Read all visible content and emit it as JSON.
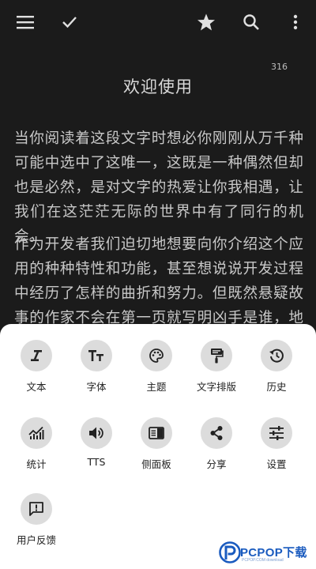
{
  "toolbar": {
    "icons": [
      "menu-icon",
      "check-icon",
      "star-icon",
      "search-icon",
      "more-vert-icon"
    ]
  },
  "reader": {
    "page_number": "316",
    "chapter_title": "欢迎使用",
    "paragraph_1": "当你阅读着这段文字时想必你刚刚从万千种可能中选中了这唯一，这既是一种偶然但却也是必然，是对文字的热爱让你我相遇，让我们在这茫茫无际的世界中有了同行的机会。",
    "paragraph_2": "作为开发者我们迫切地想要向你介绍这个应用的种种特性和功能，甚至想说说开发过程中经历了怎样的曲折和努力。但既然悬疑故事的作家不会在第一页就写明凶手是谁，地下城迷宫"
  },
  "menu": {
    "items": [
      {
        "label": "文本",
        "icon": "italic-text-icon"
      },
      {
        "label": "字体",
        "icon": "font-size-icon"
      },
      {
        "label": "主题",
        "icon": "palette-icon"
      },
      {
        "label": "文字排版",
        "icon": "paint-roller-icon"
      },
      {
        "label": "历史",
        "icon": "history-icon"
      },
      {
        "label": "统计",
        "icon": "stats-chart-icon"
      },
      {
        "label": "TTS",
        "icon": "speaker-icon"
      },
      {
        "label": "侧面板",
        "icon": "side-panel-icon"
      },
      {
        "label": "分享",
        "icon": "share-icon"
      },
      {
        "label": "设置",
        "icon": "tune-icon"
      },
      {
        "label": "用户反馈",
        "icon": "feedback-icon"
      }
    ]
  },
  "watermark": {
    "text": "PCPOP下载",
    "subtext": "PCPOP.COM download"
  },
  "colors": {
    "background": "#1b1b1b",
    "sheet": "#ffffff",
    "icon_circle": "#dcdcdc",
    "watermark_blue": "#1a5bbf"
  }
}
